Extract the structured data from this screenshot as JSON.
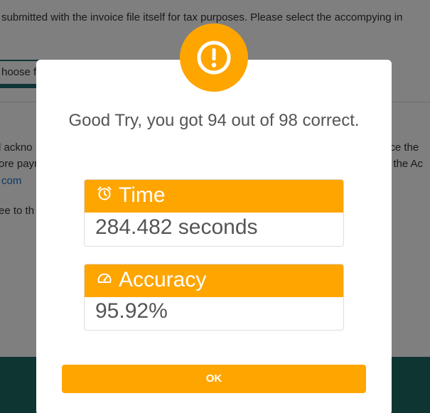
{
  "background": {
    "instruction_line": "submitted with the invoice file itself for tax purposes. Please select the accompying in",
    "choose_file_label": "hoose f",
    "left_snippets": [
      "l ackno",
      "ore payr",
      "com",
      "ee to th"
    ],
    "right_snippets": [
      "nce the",
      "t the Ac"
    ]
  },
  "modal": {
    "alert_icon": "exclamation-circle-icon",
    "result_message": "Good Try, you got 94 out of 98 correct.",
    "time": {
      "icon": "alarm-clock-icon",
      "label": "Time",
      "value": "284.482 seconds"
    },
    "accuracy": {
      "icon": "gauge-icon",
      "label": "Accuracy",
      "value": "95.92%"
    },
    "ok_label": "OK"
  },
  "colors": {
    "accent": "#ffa500",
    "footer": "#1f6b66",
    "text": "#555555"
  }
}
